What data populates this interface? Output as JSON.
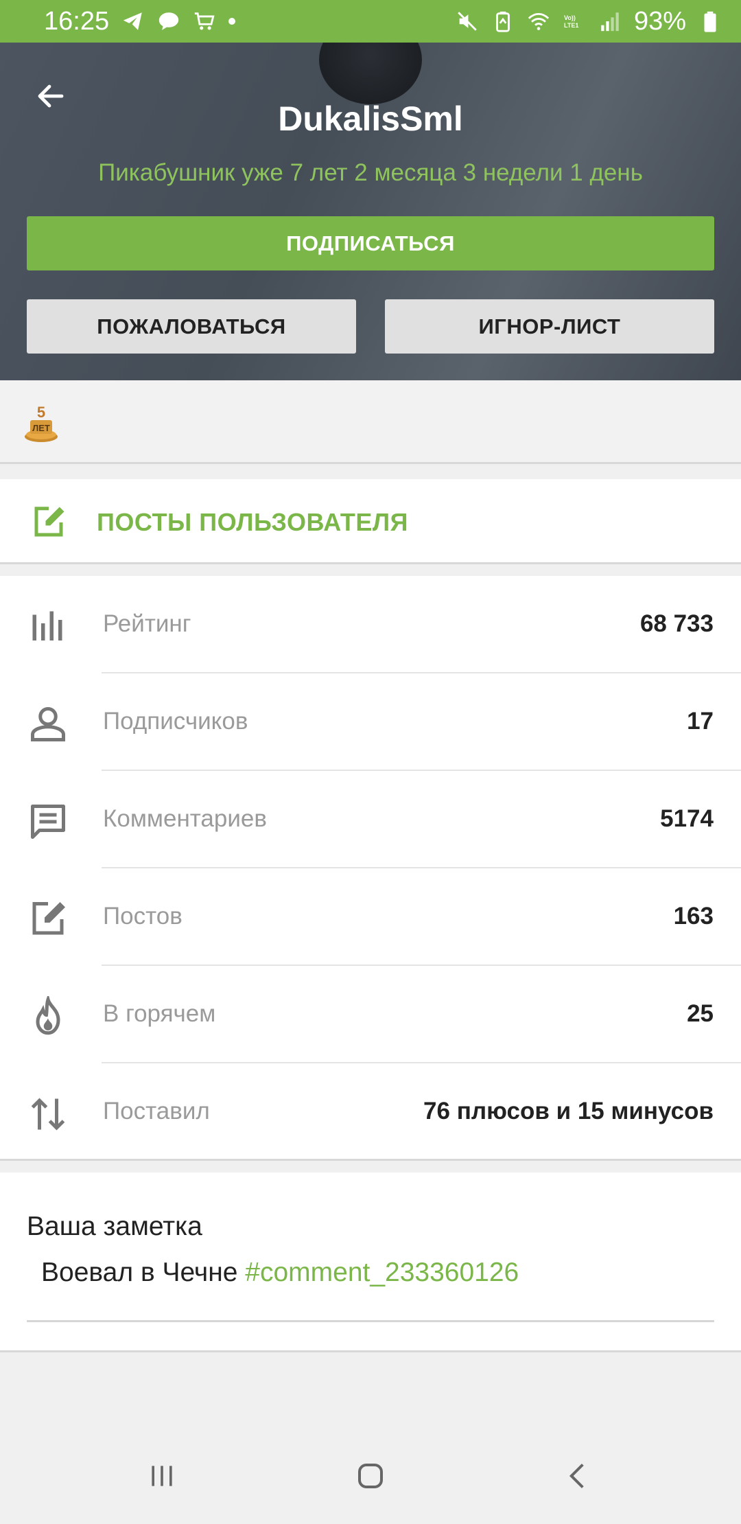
{
  "status_bar": {
    "time": "16:25",
    "battery": "93%",
    "left_icons": [
      "telegram-icon",
      "message-icon",
      "cart-icon",
      "dot-icon"
    ],
    "right_icons": [
      "mute-icon",
      "battery-saver-icon",
      "wifi-icon",
      "volte-icon",
      "signal-icon",
      "battery-icon"
    ],
    "volte_label": "Vo))\nLTE1",
    "color": "#7ab648"
  },
  "header": {
    "username": "DukalisSml",
    "tenure": "Пикабушник уже 7 лет 2 месяца 3 недели 1 день",
    "subscribe_label": "ПОДПИСАТЬСЯ",
    "report_label": "ПОЖАЛОВАТЬСЯ",
    "ignore_label": "ИГНОР-ЛИСТ",
    "back_icon": "arrow-left-icon"
  },
  "awards": {
    "badge_icon": "five-years-award-icon",
    "badge_text_top": "5",
    "badge_text_bottom": "ЛЕТ"
  },
  "posts_link": {
    "label": "ПОСТЫ ПОЛЬЗОВАТЕЛЯ",
    "icon": "edit-icon"
  },
  "stats": [
    {
      "icon": "rating-bars-icon",
      "label": "Рейтинг",
      "value": "68 733"
    },
    {
      "icon": "person-icon",
      "label": "Подписчиков",
      "value": "17"
    },
    {
      "icon": "comment-icon",
      "label": "Комментариев",
      "value": "5174"
    },
    {
      "icon": "edit-icon",
      "label": "Постов",
      "value": "163"
    },
    {
      "icon": "flame-icon",
      "label": "В горячем",
      "value": "25"
    },
    {
      "icon": "sort-arrows-icon",
      "label": "Поставил",
      "value": "76 плюсов и 15 минусов"
    }
  ],
  "note": {
    "title": "Ваша заметка",
    "text": "Воевал в Чечне ",
    "link": "#comment_233360126"
  },
  "navbar": {
    "recents_icon": "recents-icon",
    "home_icon": "home-icon",
    "back_icon": "back-chevron-icon"
  },
  "colors": {
    "accent": "#7ab648",
    "header_bg": "#4c5560",
    "button_gray": "#e0e0e0"
  }
}
